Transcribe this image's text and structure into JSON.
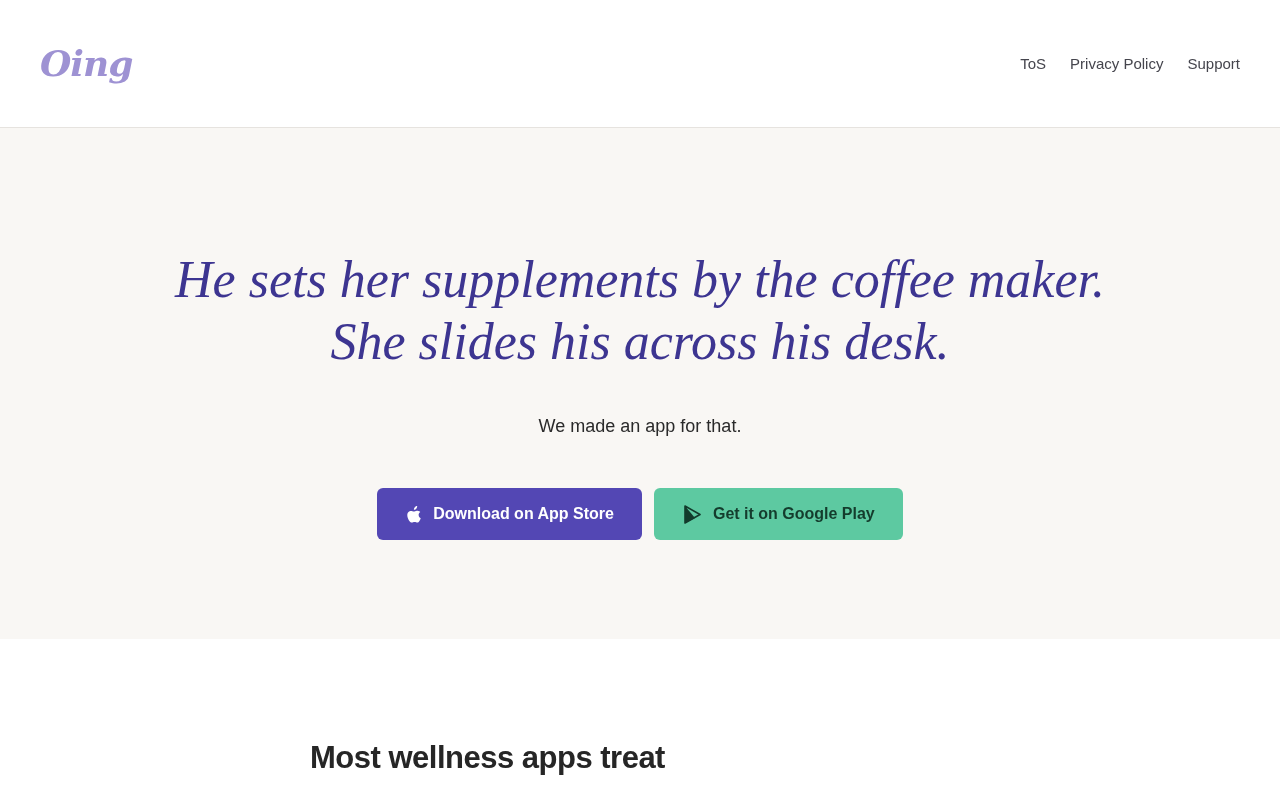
{
  "header": {
    "logo": "Oing",
    "nav": [
      "ToS",
      "Privacy Policy",
      "Support"
    ]
  },
  "hero": {
    "headline": [
      "He sets her supplements by the coffee maker.",
      "She slides his across his desk."
    ],
    "tagline": "We made an app for that.",
    "buttons": [
      {
        "kind": "app-store",
        "label": "Download on App Store"
      },
      {
        "kind": "google-play",
        "label": "Get it on Google Play"
      }
    ]
  },
  "intro": {
    "heading": "Most wellness apps treat"
  }
}
